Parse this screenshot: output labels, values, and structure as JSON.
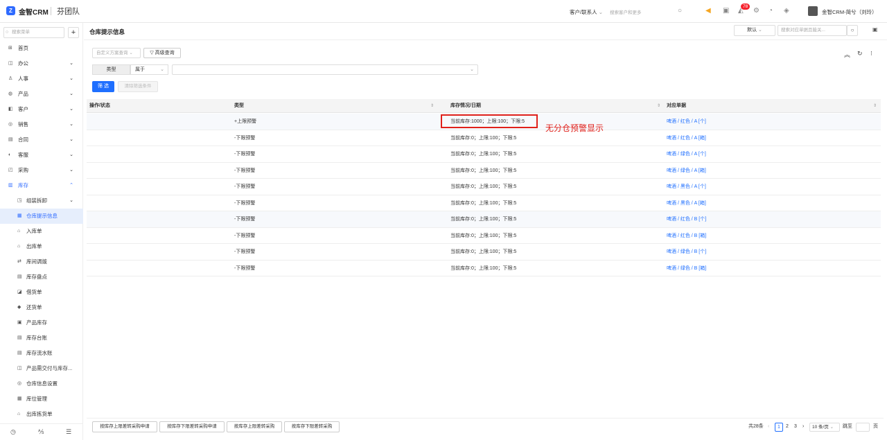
{
  "header": {
    "logo_glyph": "Z",
    "brand": "金智CRM",
    "team": "芬团队",
    "customer_select": "客户/联系人",
    "search_placeholder": "搜索客户和更多",
    "notification_count": "78",
    "user_name": "金智CRM-简兮（刘玲）",
    "icons": [
      "search-icon",
      "speaker-icon",
      "inbox-icon",
      "bell-icon",
      "gear-icon",
      "chart-icon",
      "shield-icon"
    ]
  },
  "sidebar": {
    "search_placeholder": "搜索菜单",
    "add_label": "+",
    "items": [
      {
        "label": "首页",
        "icon": "⊞",
        "arrow": ""
      },
      {
        "label": "办公",
        "icon": "◫",
        "arrow": "⌄"
      },
      {
        "label": "人事",
        "icon": "♙",
        "arrow": "⌄"
      },
      {
        "label": "产品",
        "icon": "◍",
        "arrow": "⌄"
      },
      {
        "label": "客户",
        "icon": "◧",
        "arrow": "⌄"
      },
      {
        "label": "销售",
        "icon": "◎",
        "arrow": "⌄"
      },
      {
        "label": "合同",
        "icon": "▤",
        "arrow": "⌄"
      },
      {
        "label": "客服",
        "icon": "◐",
        "arrow": "⌄"
      },
      {
        "label": "采购",
        "icon": "◰",
        "arrow": "⌄"
      },
      {
        "label": "库存",
        "icon": "▥",
        "arrow": "⌃"
      }
    ],
    "subitems": [
      {
        "label": "组装拆卸",
        "icon": "◳",
        "arrow": "⌄"
      },
      {
        "label": "仓库提示信息",
        "icon": "▦",
        "arrow": ""
      },
      {
        "label": "入库单",
        "icon": "⌂",
        "arrow": ""
      },
      {
        "label": "出库单",
        "icon": "⌂",
        "arrow": ""
      },
      {
        "label": "库间调拨",
        "icon": "⇄",
        "arrow": ""
      },
      {
        "label": "库存盘点",
        "icon": "▤",
        "arrow": ""
      },
      {
        "label": "借货单",
        "icon": "◪",
        "arrow": ""
      },
      {
        "label": "还货单",
        "icon": "◆",
        "arrow": ""
      },
      {
        "label": "产品库存",
        "icon": "▣",
        "arrow": ""
      },
      {
        "label": "库存台账",
        "icon": "▤",
        "arrow": ""
      },
      {
        "label": "库存流水账",
        "icon": "▤",
        "arrow": ""
      },
      {
        "label": "产品需交付与库存...",
        "icon": "◫",
        "arrow": ""
      },
      {
        "label": "仓库信息设置",
        "icon": "◎",
        "arrow": ""
      },
      {
        "label": "库位管理",
        "icon": "▦",
        "arrow": ""
      },
      {
        "label": "出库拣货单",
        "icon": "⌂",
        "arrow": ""
      }
    ]
  },
  "page": {
    "title": "仓库提示信息",
    "view_select": "默认",
    "search_placeholder": "搜索对应单据且能关..."
  },
  "filter": {
    "custom_query_placeholder": "自定义方案查询",
    "advanced_label": "高级查询",
    "field_label": "类型",
    "operator": "属于",
    "filter_button": "筛 选",
    "clear_button": "清除筛选条件"
  },
  "table": {
    "columns": [
      "操作/状态",
      "类型",
      "库存情况/日期",
      "对应单据"
    ],
    "rows": [
      {
        "type": "+上限预警",
        "stock": "当前库存:1000；上限:100；下限:5",
        "ref": "啤酒 / 红色 / A [个]"
      },
      {
        "type": "-下限预警",
        "stock": "当前库存:0；上限:100；下限:5",
        "ref": "啤酒 / 红色 / A [箱]"
      },
      {
        "type": "-下限预警",
        "stock": "当前库存:0；上限:100；下限:5",
        "ref": "啤酒 / 绿色 / A [个]"
      },
      {
        "type": "-下限预警",
        "stock": "当前库存:0；上限:100；下限:5",
        "ref": "啤酒 / 绿色 / A [箱]"
      },
      {
        "type": "-下限预警",
        "stock": "当前库存:0；上限:100；下限:5",
        "ref": "啤酒 / 黑色 / A [个]"
      },
      {
        "type": "-下限预警",
        "stock": "当前库存:0；上限:100；下限:5",
        "ref": "啤酒 / 黑色 / A [箱]"
      },
      {
        "type": "-下限预警",
        "stock": "当前库存:0；上限:100；下限:5",
        "ref": "啤酒 / 红色 / B [个]"
      },
      {
        "type": "-下限预警",
        "stock": "当前库存:0；上限:100；下限:5",
        "ref": "啤酒 / 红色 / B [箱]"
      },
      {
        "type": "-下限预警",
        "stock": "当前库存:0；上限:100；下限:5",
        "ref": "啤酒 / 绿色 / B [个]"
      },
      {
        "type": "-下限预警",
        "stock": "当前库存:0；上限:100；下限:5",
        "ref": "啤酒 / 绿色 / B [箱]"
      }
    ]
  },
  "annotation": "无分仓预警显示",
  "footer": {
    "buttons": [
      "按库存上限差转采购申请",
      "按库存下限差转采购申请",
      "按库存上限差转采购",
      "按库存下限差转采购"
    ],
    "total": "共28条",
    "pages": [
      "1",
      "2",
      "3"
    ],
    "page_size": "10 条/页",
    "jump_label": "跳至",
    "page_suffix": "页"
  },
  "colors": {
    "accent": "#1f6fff",
    "highlight": "#e0201a",
    "badge": "#f5222d"
  }
}
